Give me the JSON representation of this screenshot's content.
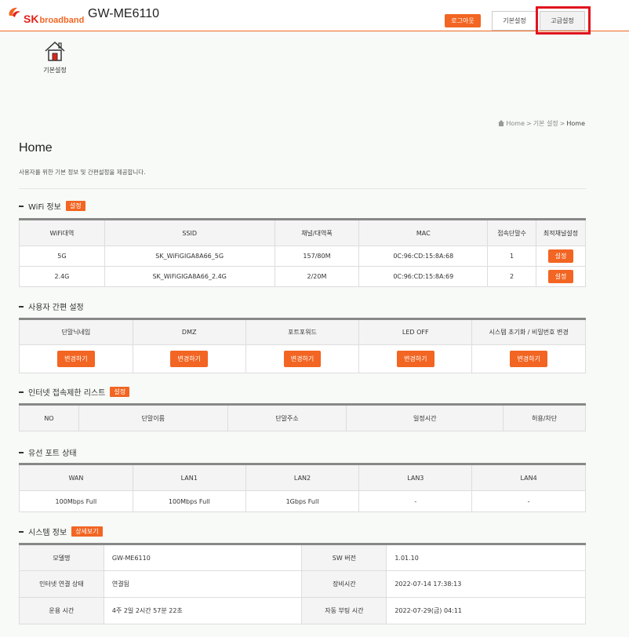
{
  "header": {
    "logo_sk": "SK",
    "logo_broadband": "broadband",
    "model": "GW-ME6110",
    "logout_label": "로그아웃",
    "tab_basic": "기본설정",
    "tab_advanced": "고급설정"
  },
  "home_shortcut": {
    "label": "기본설정",
    "icon": "home-icon"
  },
  "breadcrumb": {
    "home": "Home",
    "sep1": ">",
    "basic": "기본 설정",
    "sep2": ">",
    "current": "Home"
  },
  "page": {
    "title": "Home",
    "description": "사용자를 위한 기본 정보 및 간편설정을 제공합니다."
  },
  "wifi": {
    "title": "WiFi 정보",
    "badge": "설정",
    "headers": [
      "WiFi대역",
      "SSID",
      "채널/대역폭",
      "MAC",
      "접속단말수",
      "최적채널설정"
    ],
    "rows": [
      {
        "band": "5G",
        "ssid": "SK_WiFiGIGA8A66_5G",
        "channel": "157/80M",
        "mac": "0C:96:CD:15:8A:68",
        "clients": "1",
        "action": "설정"
      },
      {
        "band": "2.4G",
        "ssid": "SK_WiFiGIGA8A66_2.4G",
        "channel": "2/20M",
        "mac": "0C:96:CD:15:8A:69",
        "clients": "2",
        "action": "설정"
      }
    ]
  },
  "quick": {
    "title": "사용자 간편 설정",
    "headers": [
      "단말닉네임",
      "DMZ",
      "포트포워드",
      "LED OFF",
      "시스템 초기화 / 비밀번호 변경"
    ],
    "button_label": "변경하기"
  },
  "blocklist": {
    "title": "인터넷 접속제한 리스트",
    "badge": "설정",
    "headers": [
      "NO",
      "단말이름",
      "단말주소",
      "일정시간",
      "허용/차단"
    ]
  },
  "ports": {
    "title": "유선 포트 상태",
    "headers": [
      "WAN",
      "LAN1",
      "LAN2",
      "LAN3",
      "LAN4"
    ],
    "values": [
      "100Mbps Full",
      "100Mbps Full",
      "1Gbps Full",
      "-",
      "-"
    ]
  },
  "system": {
    "title": "시스템 정보",
    "badge": "상세보기",
    "rows": [
      {
        "l1": "모델명",
        "v1": "GW-ME6110",
        "l2": "SW 버전",
        "v2": "1.01.10"
      },
      {
        "l1": "인터넷 연결 상태",
        "v1": "연결됨",
        "l2": "장비시간",
        "v2": "2022-07-14 17:38:13"
      },
      {
        "l1": "운용 시간",
        "v1": "4주 2일 2시간 57분 22초",
        "l2": "자동 부팅 시간",
        "v2": "2022-07-29(금) 04:11"
      }
    ]
  },
  "colors": {
    "accent": "#f26522",
    "highlight": "#e0141e",
    "logo_red": "#e2231a"
  }
}
